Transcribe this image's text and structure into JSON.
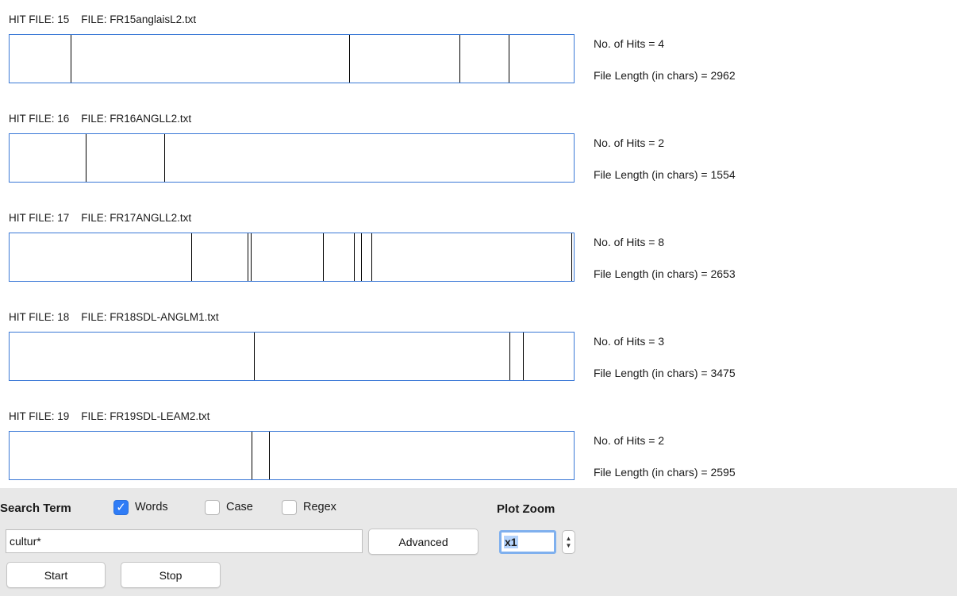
{
  "files": [
    {
      "header": "HIT FILE: 15    FILE: FR15anglaisL2.txt",
      "hits_text": "No. of Hits = 4",
      "length_text": "File Length (in chars) = 2962",
      "hit_positions": [
        0.108,
        0.602,
        0.798,
        0.884
      ]
    },
    {
      "header": "HIT FILE: 16    FILE: FR16ANGLL2.txt",
      "hits_text": "No. of Hits = 2",
      "length_text": "File Length (in chars) = 1554",
      "hit_positions": [
        0.135,
        0.274
      ]
    },
    {
      "header": "HIT FILE: 17    FILE: FR17ANGLL2.txt",
      "hits_text": "No. of Hits = 8",
      "length_text": "File Length (in chars) = 2653",
      "hit_positions": [
        0.322,
        0.422,
        0.427,
        0.555,
        0.611,
        0.623,
        0.641,
        0.996
      ]
    },
    {
      "header": "HIT FILE: 18    FILE: FR18SDL-ANGLM1.txt",
      "hits_text": "No. of Hits = 3",
      "length_text": "File Length (in chars) = 3475",
      "hit_positions": [
        0.433,
        0.886,
        0.91
      ]
    },
    {
      "header": "HIT FILE: 19    FILE: FR19SDL-LEAM2.txt",
      "hits_text": "No. of Hits = 2",
      "length_text": "File Length (in chars) = 2595",
      "hit_positions": [
        0.429,
        0.46
      ]
    }
  ],
  "controls": {
    "search_term_label": "Search Term",
    "words_label": "Words",
    "words_checked": true,
    "case_label": "Case",
    "case_checked": false,
    "regex_label": "Regex",
    "regex_checked": false,
    "plot_zoom_label": "Plot Zoom",
    "search_value": "cultur*",
    "advanced_label": "Advanced",
    "zoom_value": "x1",
    "start_label": "Start",
    "stop_label": "Stop",
    "checkmark": "✓"
  },
  "colors": {
    "accent": "#2f7cf6",
    "plot_border": "#3a78d6",
    "panel_bg": "#e8e8e8"
  }
}
